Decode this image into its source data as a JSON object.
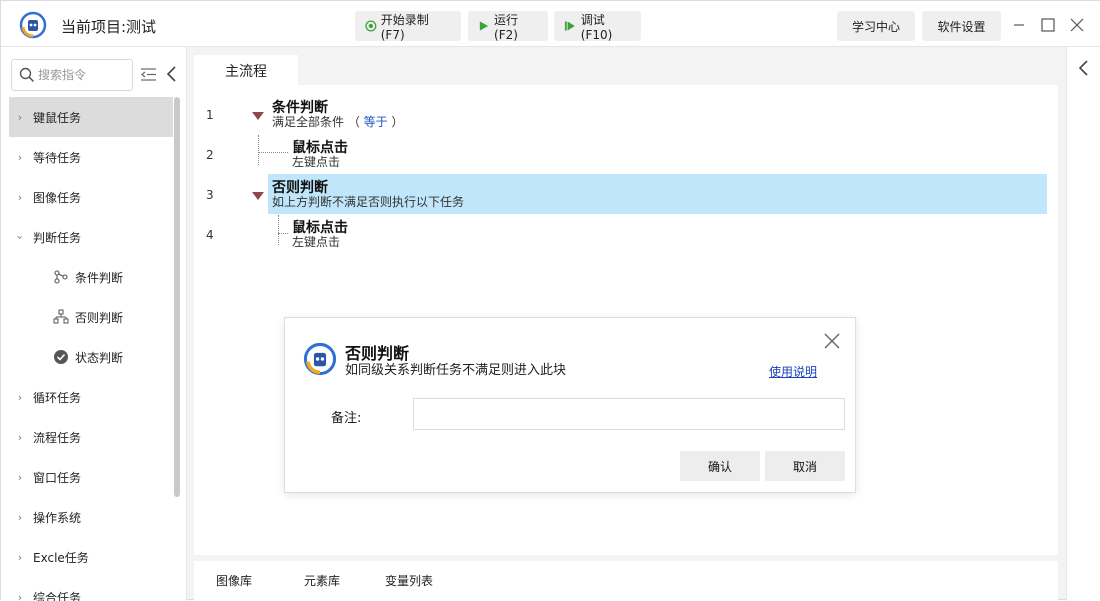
{
  "window": {
    "project_title": "当前项目:测试"
  },
  "toolbar": {
    "record_label": "开始录制(F7)",
    "run_label": "运行(F2)",
    "debug_label": "调试(F10)",
    "learn_label": "学习中心",
    "settings_label": "软件设置"
  },
  "sidebar": {
    "search_placeholder": "搜索指令",
    "categories": [
      {
        "label": "键鼠任务"
      },
      {
        "label": "等待任务"
      },
      {
        "label": "图像任务"
      },
      {
        "label": "判断任务"
      },
      {
        "label": "循环任务"
      },
      {
        "label": "流程任务"
      },
      {
        "label": "窗口任务"
      },
      {
        "label": "操作系统"
      },
      {
        "label": "Excle任务"
      },
      {
        "label": "综合任务"
      }
    ],
    "judge_subitems": [
      {
        "label": "条件判断",
        "icon": "branch-icon"
      },
      {
        "label": "否则判断",
        "icon": "else-icon"
      },
      {
        "label": "状态判断",
        "icon": "check-circle-icon"
      }
    ]
  },
  "main": {
    "tab_label": "主流程",
    "lines": [
      {
        "no": "1",
        "title": "条件判断",
        "sub_prefix": "满足全部条件 （ ",
        "sub_link": "等于",
        "sub_suffix": " ）"
      },
      {
        "no": "2",
        "title": "鼠标点击",
        "sub": "左键点击"
      },
      {
        "no": "3",
        "title": "否则判断",
        "sub": "如上方判断不满足否则执行以下任务"
      },
      {
        "no": "4",
        "title": "鼠标点击",
        "sub": "左键点击"
      }
    ]
  },
  "bottom_tabs": [
    "图像库",
    "元素库",
    "变量列表"
  ],
  "dialog": {
    "title": "否则判断",
    "description": "如同级关系判断任务不满足则进入此块",
    "help_link": "使用说明",
    "note_label": "备注:",
    "note_value": "",
    "ok_label": "确认",
    "cancel_label": "取消"
  },
  "colors": {
    "highlight_row": "#bfe6fb",
    "link_blue": "#1a56c4",
    "toggle_arrow": "#8a4a4a",
    "active_category": "#dcdcdc"
  }
}
